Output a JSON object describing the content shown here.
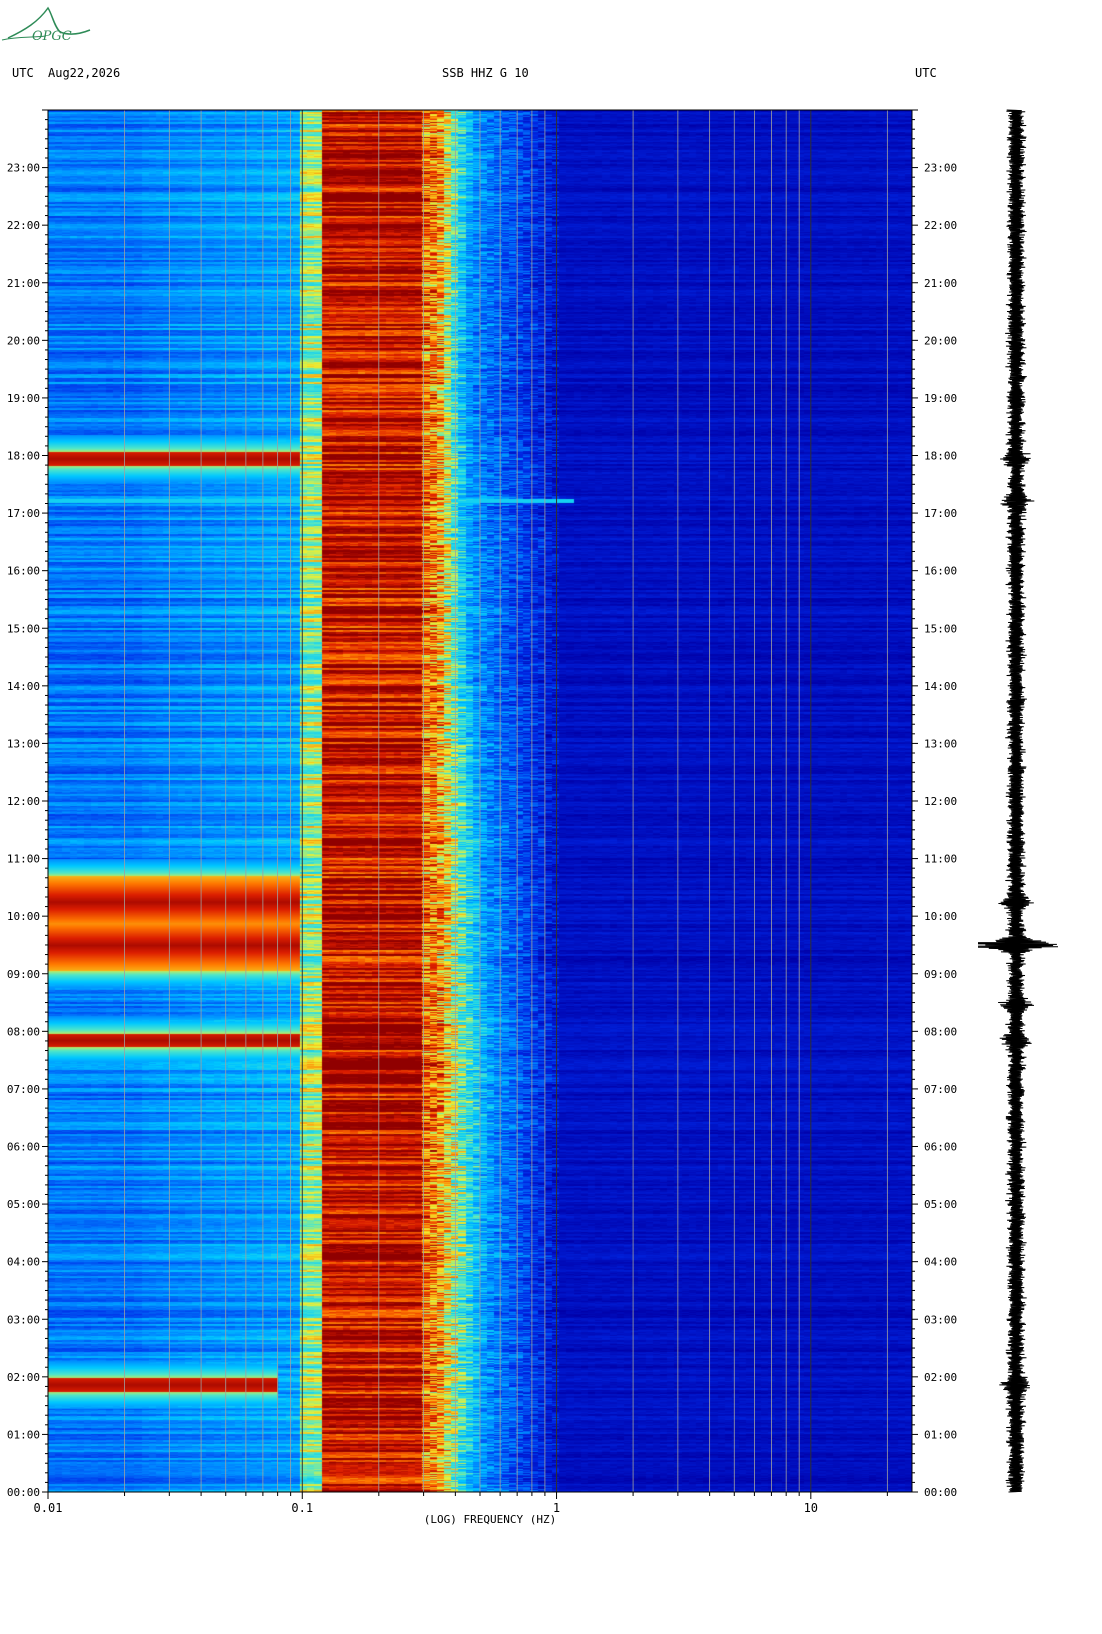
{
  "header": {
    "left_tz": "UTC",
    "date": "Aug22,2026",
    "station": "SSB HHZ G 10",
    "right_tz": "UTC",
    "logo_text": "OPGC"
  },
  "colors": {
    "background": "#ffffff",
    "low": "#0000a8",
    "mid": "#00c8ff",
    "yellow": "#f0f030",
    "high": "#900000",
    "grid": "#a0a0a0",
    "logo": "#2e8b57",
    "trace": "#000000"
  },
  "chart_data": {
    "type": "heatmap",
    "subtype": "spectrogram",
    "xlabel": "(LOG) FREQUENCY (HZ)",
    "x_scale": "log",
    "xlim": [
      0.01,
      25
    ],
    "x_ticks": [
      {
        "value": 0.01,
        "label": "0.01"
      },
      {
        "value": 0.1,
        "label": "0.1"
      },
      {
        "value": 1,
        "label": "1"
      },
      {
        "value": 10,
        "label": "10"
      }
    ],
    "ylim_hours": [
      0,
      24
    ],
    "y_ticks": [
      "00:00",
      "01:00",
      "02:00",
      "03:00",
      "04:00",
      "05:00",
      "06:00",
      "07:00",
      "08:00",
      "09:00",
      "10:00",
      "11:00",
      "12:00",
      "13:00",
      "14:00",
      "15:00",
      "16:00",
      "17:00",
      "18:00",
      "19:00",
      "20:00",
      "21:00",
      "22:00",
      "23:00"
    ],
    "grid": "vertical",
    "microseism_band_hz": [
      0.12,
      0.3
    ],
    "events": [
      {
        "time_utc": "01:52",
        "low_freq_max_hz": 0.08
      },
      {
        "time_utc": "07:51",
        "low_freq_max_hz": 0.1
      },
      {
        "time_utc": "09:30",
        "low_freq_max_hz": 0.1
      },
      {
        "time_utc": "10:15",
        "low_freq_max_hz": 0.1
      },
      {
        "time_utc": "17:13",
        "low_freq_max_hz": 1.2
      },
      {
        "time_utc": "17:57",
        "low_freq_max_hz": 0.1
      },
      {
        "time_utc": "08:28",
        "low_freq_max_hz": 0.6
      }
    ],
    "seismogram": {
      "type": "waveform",
      "peak_time_utc": "09:30"
    }
  }
}
